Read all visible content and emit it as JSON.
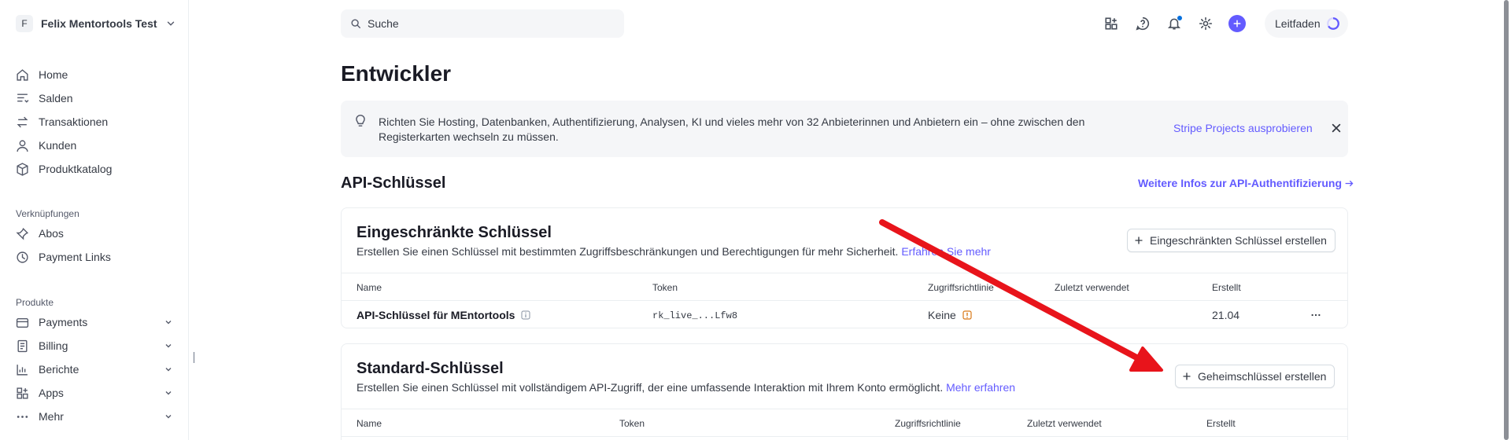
{
  "account": {
    "initial": "F",
    "name": "Felix Mentortools Test"
  },
  "sidebar": {
    "main_items": [
      {
        "label": "Home",
        "icon": "home-icon"
      },
      {
        "label": "Salden",
        "icon": "balances-icon"
      },
      {
        "label": "Transaktionen",
        "icon": "transactions-icon"
      },
      {
        "label": "Kunden",
        "icon": "customers-icon"
      },
      {
        "label": "Produktkatalog",
        "icon": "product-catalog-icon"
      }
    ],
    "shortcuts_label": "Verknüpfungen",
    "shortcuts": [
      {
        "label": "Abos",
        "icon": "pin-icon"
      },
      {
        "label": "Payment Links",
        "icon": "clock-icon"
      }
    ],
    "products_label": "Produkte",
    "products": [
      {
        "label": "Payments",
        "icon": "payments-icon"
      },
      {
        "label": "Billing",
        "icon": "billing-icon"
      },
      {
        "label": "Berichte",
        "icon": "reports-icon"
      },
      {
        "label": "Apps",
        "icon": "apps-icon"
      },
      {
        "label": "Mehr",
        "icon": "more-dots-icon"
      }
    ]
  },
  "search": {
    "placeholder": "Suche"
  },
  "topbar": {
    "guide_label": "Leitfaden",
    "icons": [
      "apps-grid-icon",
      "help-icon",
      "notification-bell-icon",
      "settings-gear-icon",
      "create-plus-icon"
    ]
  },
  "page": {
    "title": "Entwickler",
    "banner": {
      "text": "Richten Sie Hosting, Datenbanken, Authentifizierung, Analysen, KI und vieles mehr von 32 Anbieterinnen und Anbietern ein – ohne zwischen den Registerkarten wechseln zu müssen.",
      "link": "Stripe Projects ausprobieren"
    },
    "api_section_title": "API-Schlüssel",
    "api_section_link": "Weitere Infos zur API-Authentifizierung"
  },
  "restricted": {
    "title": "Eingeschränkte Schlüssel",
    "desc": "Erstellen Sie einen Schlüssel mit bestimmten Zugriffsbeschränkungen und Berechtigungen für mehr Sicherheit.",
    "desc_link": "Erfahren Sie mehr",
    "button": "Eingeschränkten Schlüssel erstellen",
    "columns": [
      "Name",
      "Token",
      "Zugriffsrichtlinie",
      "Zuletzt verwendet",
      "Erstellt"
    ],
    "row": {
      "name": "API-Schlüssel für MEntortools",
      "token": "rk_live_...Lfw8",
      "policy": "Keine",
      "last_used": "",
      "created": "21.04"
    }
  },
  "standard": {
    "title": "Standard-Schlüssel",
    "desc": "Erstellen Sie einen Schlüssel mit vollständigem API-Zugriff, der eine umfassende Interaktion mit Ihrem Konto ermöglicht.",
    "desc_link": "Mehr erfahren",
    "button": "Geheimschlüssel erstellen",
    "columns": [
      "Name",
      "Token",
      "Zugriffsrichtlinie",
      "Zuletzt verwendet",
      "Erstellt"
    ]
  },
  "colors": {
    "accent": "#635bff",
    "annotation_arrow": "#e8141b"
  }
}
